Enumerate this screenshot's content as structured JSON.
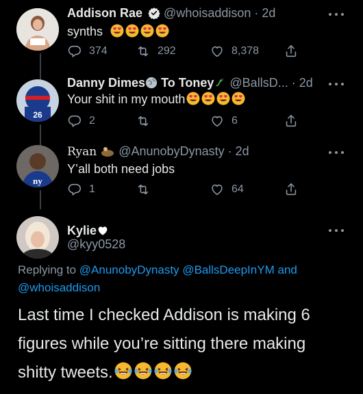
{
  "thread": [
    {
      "display_name": "Addison Rae",
      "verified": true,
      "handle": "@whoisaddison",
      "time": "· 2d",
      "text": "synths",
      "emoji_count": 4,
      "emoji": "heart-eyes",
      "replies": "374",
      "retweets": "292",
      "likes": "8,378"
    },
    {
      "display_name": "Danny Dimes",
      "display_name_2": "To Toney",
      "handle": "@BallsD...",
      "time": "· 2d",
      "text": "Your shit in my mouth",
      "emoji_count": 4,
      "emoji": "heart-eyes",
      "replies": "2",
      "retweets": "",
      "likes": "6"
    },
    {
      "display_name": "Ryan",
      "handle": "@AnunobyDynasty",
      "time": "· 2d",
      "text": "Y’all both need jobs",
      "replies": "1",
      "retweets": "",
      "likes": "64"
    }
  ],
  "main_tweet": {
    "display_name": "Kylie",
    "handle": "@kyy0528",
    "replying_prefix": "Replying to",
    "reply_handles": [
      "@AnunobyDynasty",
      "@BallsDeepInYM"
    ],
    "reply_and": "and",
    "reply_handle_last": "@whoisaddison",
    "text_line1": "Last time I checked Addison is making 6",
    "text_line2": "figures while you’re sitting there making",
    "text_line3": "shitty tweets.",
    "emoji": "laughing-tears",
    "emoji_count": 4
  },
  "colors": {
    "background": "#000000",
    "text": "#e7e9ea",
    "muted": "#8b98a5",
    "link": "#1d9bf0",
    "verified": "#1d9bf0"
  }
}
